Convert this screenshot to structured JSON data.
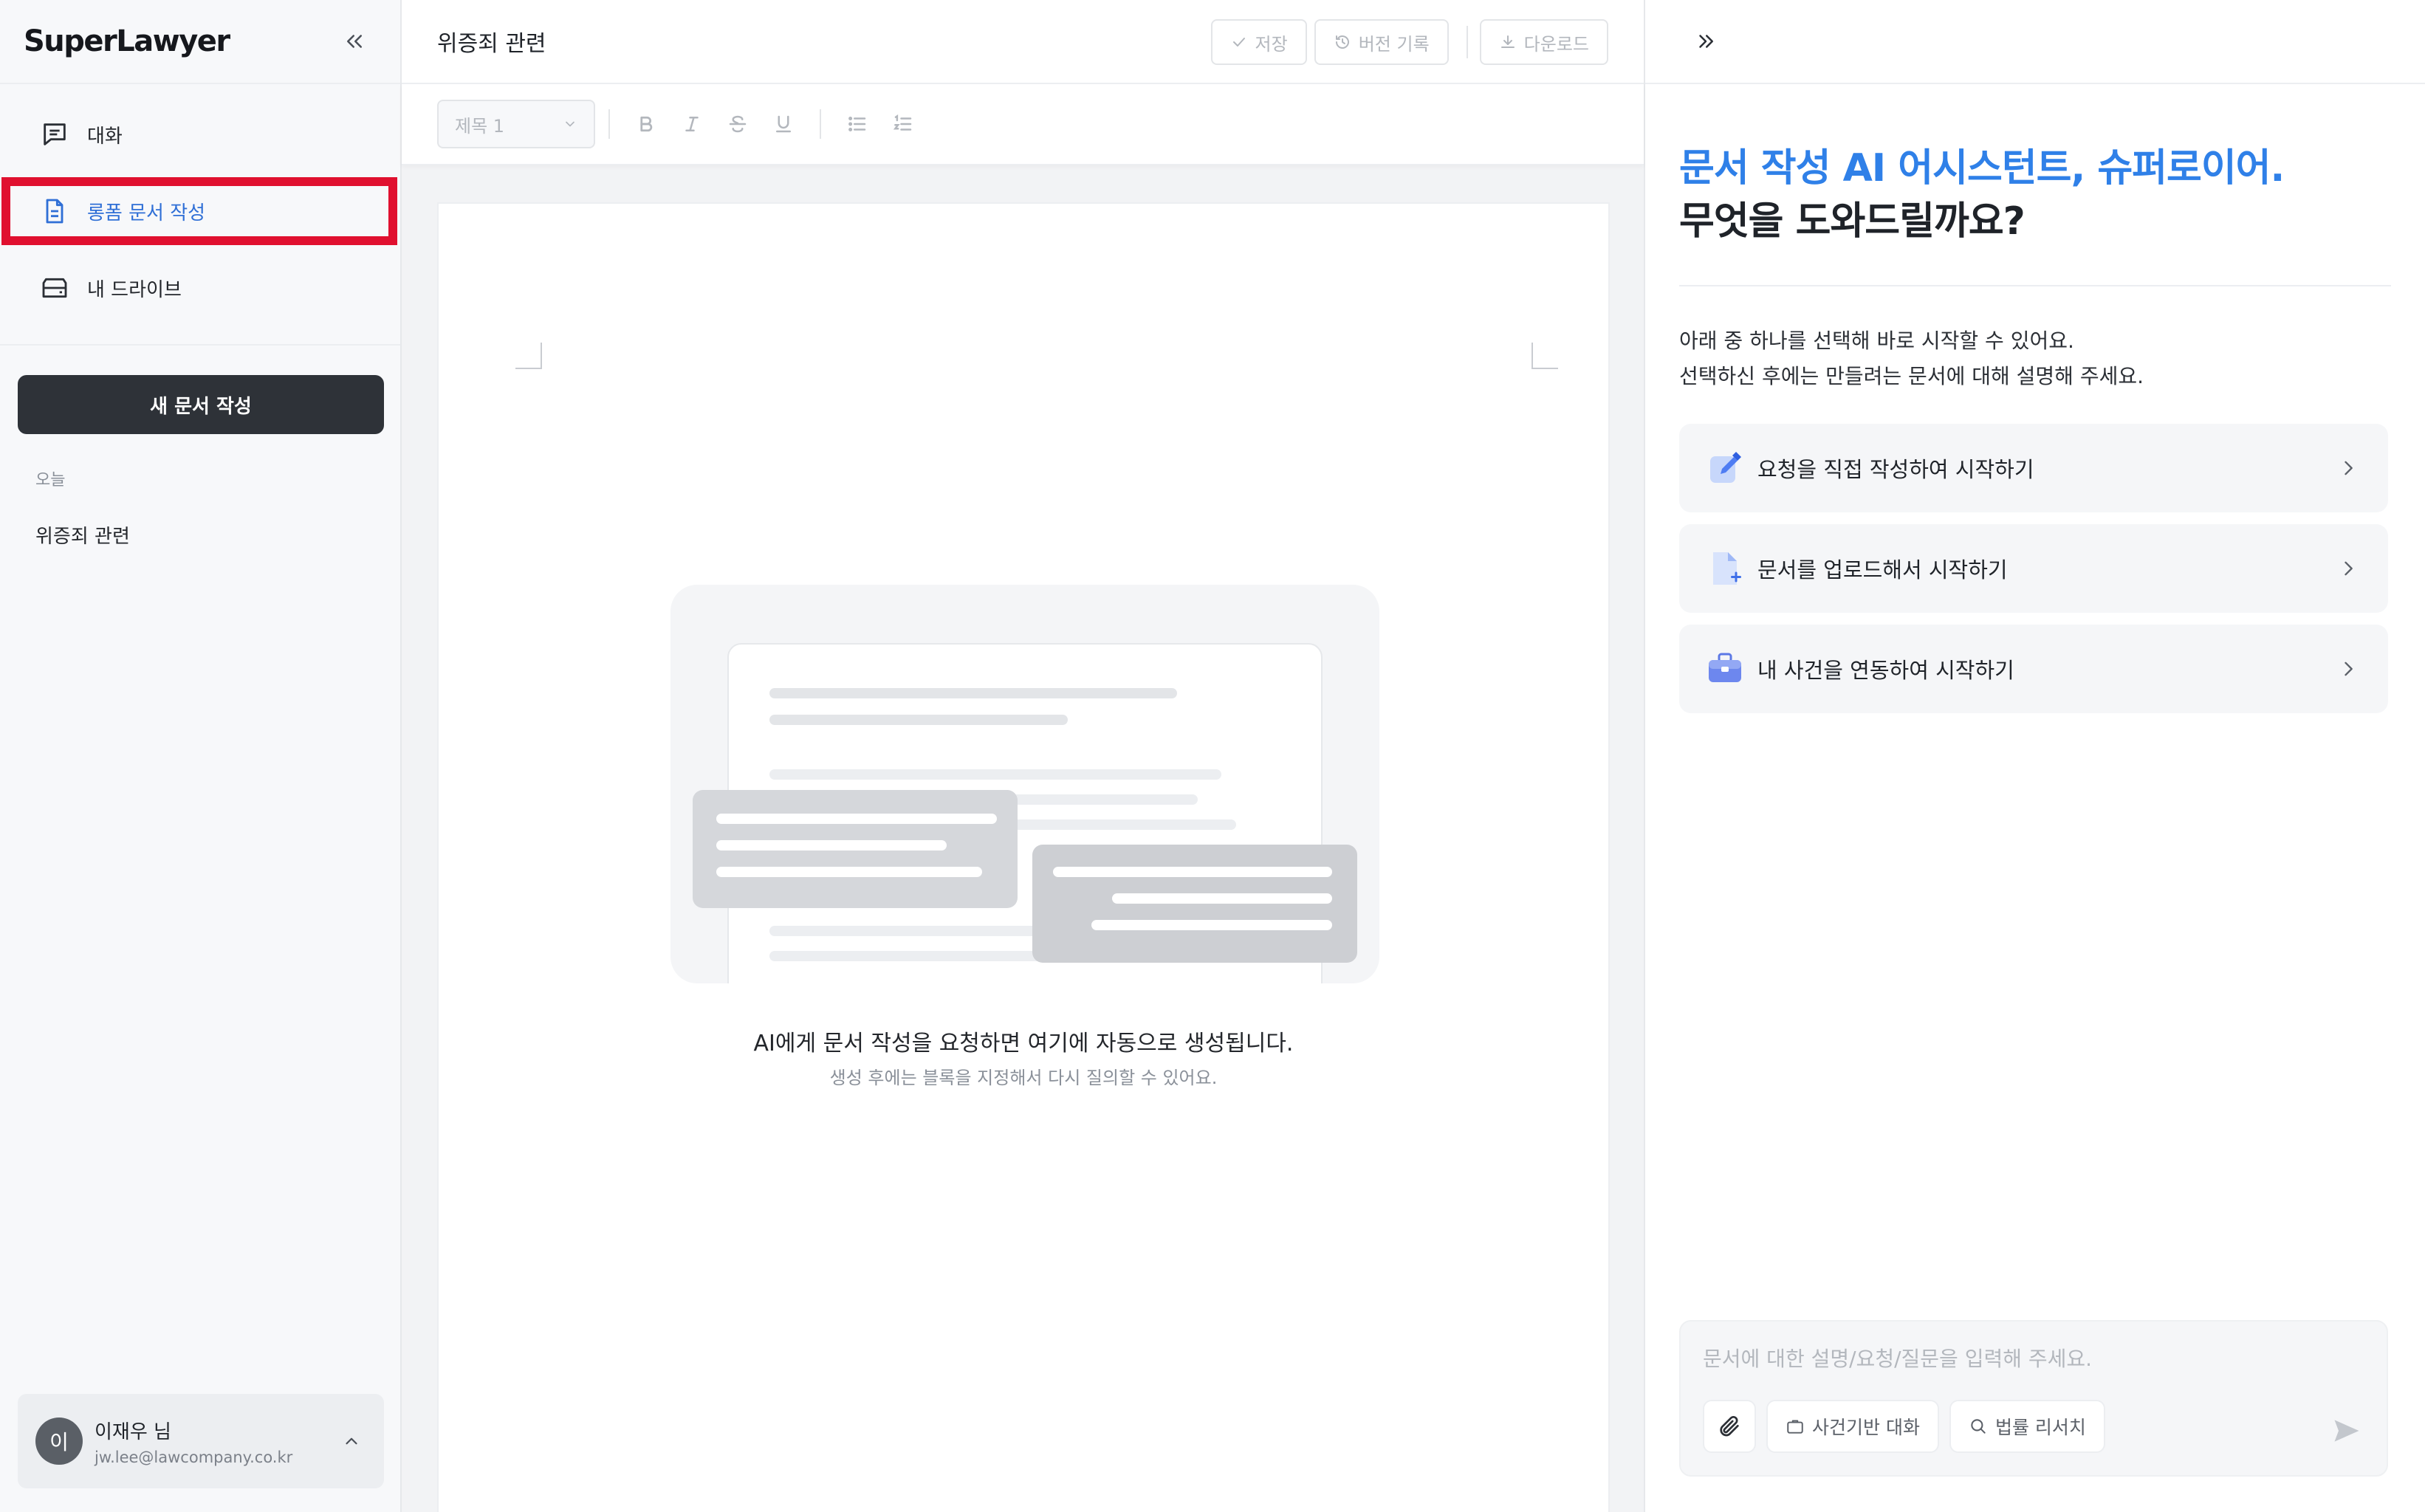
{
  "app": {
    "logo": "SuperLawyer"
  },
  "sidebar": {
    "items": [
      {
        "label": "대화",
        "icon": "chat-icon"
      },
      {
        "label": "롱폼 문서 작성",
        "icon": "document-icon",
        "active": true
      },
      {
        "label": "내 드라이브",
        "icon": "drive-icon"
      }
    ],
    "new_doc_label": "새 문서 작성",
    "section_label": "오늘",
    "history": [
      "위증죄 관련"
    ],
    "user": {
      "initial": "이",
      "name": "이재우 님",
      "email": "jw.lee@lawcompany.co.kr"
    }
  },
  "editor": {
    "doc_title": "위증죄 관련",
    "actions": {
      "save": "저장",
      "history": "버전 기록",
      "download": "다운로드"
    },
    "toolbar": {
      "heading": "제목 1"
    },
    "empty_state": {
      "title": "AI에게 문서 작성을 요청하면 여기에 자동으로 생성됩니다.",
      "subtitle": "생성 후에는 블록을 지정해서 다시 질의할 수 있어요."
    }
  },
  "assistant": {
    "title_accent": "문서 작성 AI 어시스턴트, 슈퍼로이어.",
    "title_plain": "무엇을 도와드릴까요?",
    "intro_1": "아래 중 하나를 선택해 바로 시작할 수 있어요.",
    "intro_2": "선택하신 후에는 만들려는 문서에 대해 설명해 주세요.",
    "options": [
      {
        "label": "요청을 직접 작성하여 시작하기",
        "icon": "pencil-note-icon"
      },
      {
        "label": "문서를 업로드해서 시작하기",
        "icon": "file-add-icon"
      },
      {
        "label": "내 사건을 연동하여 시작하기",
        "icon": "briefcase-icon"
      }
    ],
    "composer": {
      "placeholder": "문서에 대한 설명/요청/질문을 입력해 주세요.",
      "chip_case": "사건기반 대화",
      "chip_research": "법률 리서치"
    }
  },
  "colors": {
    "accent": "#2f80e8",
    "active_nav": "#2f6fd6",
    "highlight": "#e0102f",
    "dark_button": "#2e3238"
  }
}
